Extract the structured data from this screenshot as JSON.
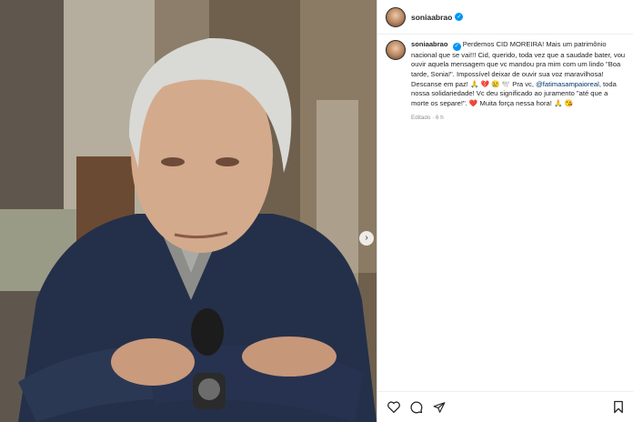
{
  "post": {
    "username": "soniaabrao",
    "caption": {
      "username": "soniaabrao",
      "part1": "Perdemos CID MOREIRA! Mais um patrimônio nacional que se vai!!! Cid, querido, toda vez que a saudade bater, vou ouvir aquela mensagem que vc mandou pra mim com um lindo \"Boa tarde, Sonia!\". Impossível deixar de ouvir sua voz maravilhosa! Descanse em paz!",
      "emojis1": "🙏 💔 😢 🕊️",
      "part2": "Pra vc,",
      "mention": "@fatimasampaioreal",
      "part3": ", toda nossa solidariedade! Vc deu significado ao juramento \"até que a morte os separe!\".",
      "heart": "❤️",
      "part4": "Muita força nessa hora!",
      "emojis2": "🙏 😘"
    },
    "meta": "Editado · 6 h",
    "icons": {
      "like": "heart-icon",
      "comment": "comment-icon",
      "share": "share-icon",
      "save": "bookmark-icon",
      "carousel": "chevron-right-icon"
    },
    "colors": {
      "verified": "#0095f6",
      "mention": "#00376b",
      "meta": "#8e8e8e",
      "text": "#262626"
    }
  }
}
